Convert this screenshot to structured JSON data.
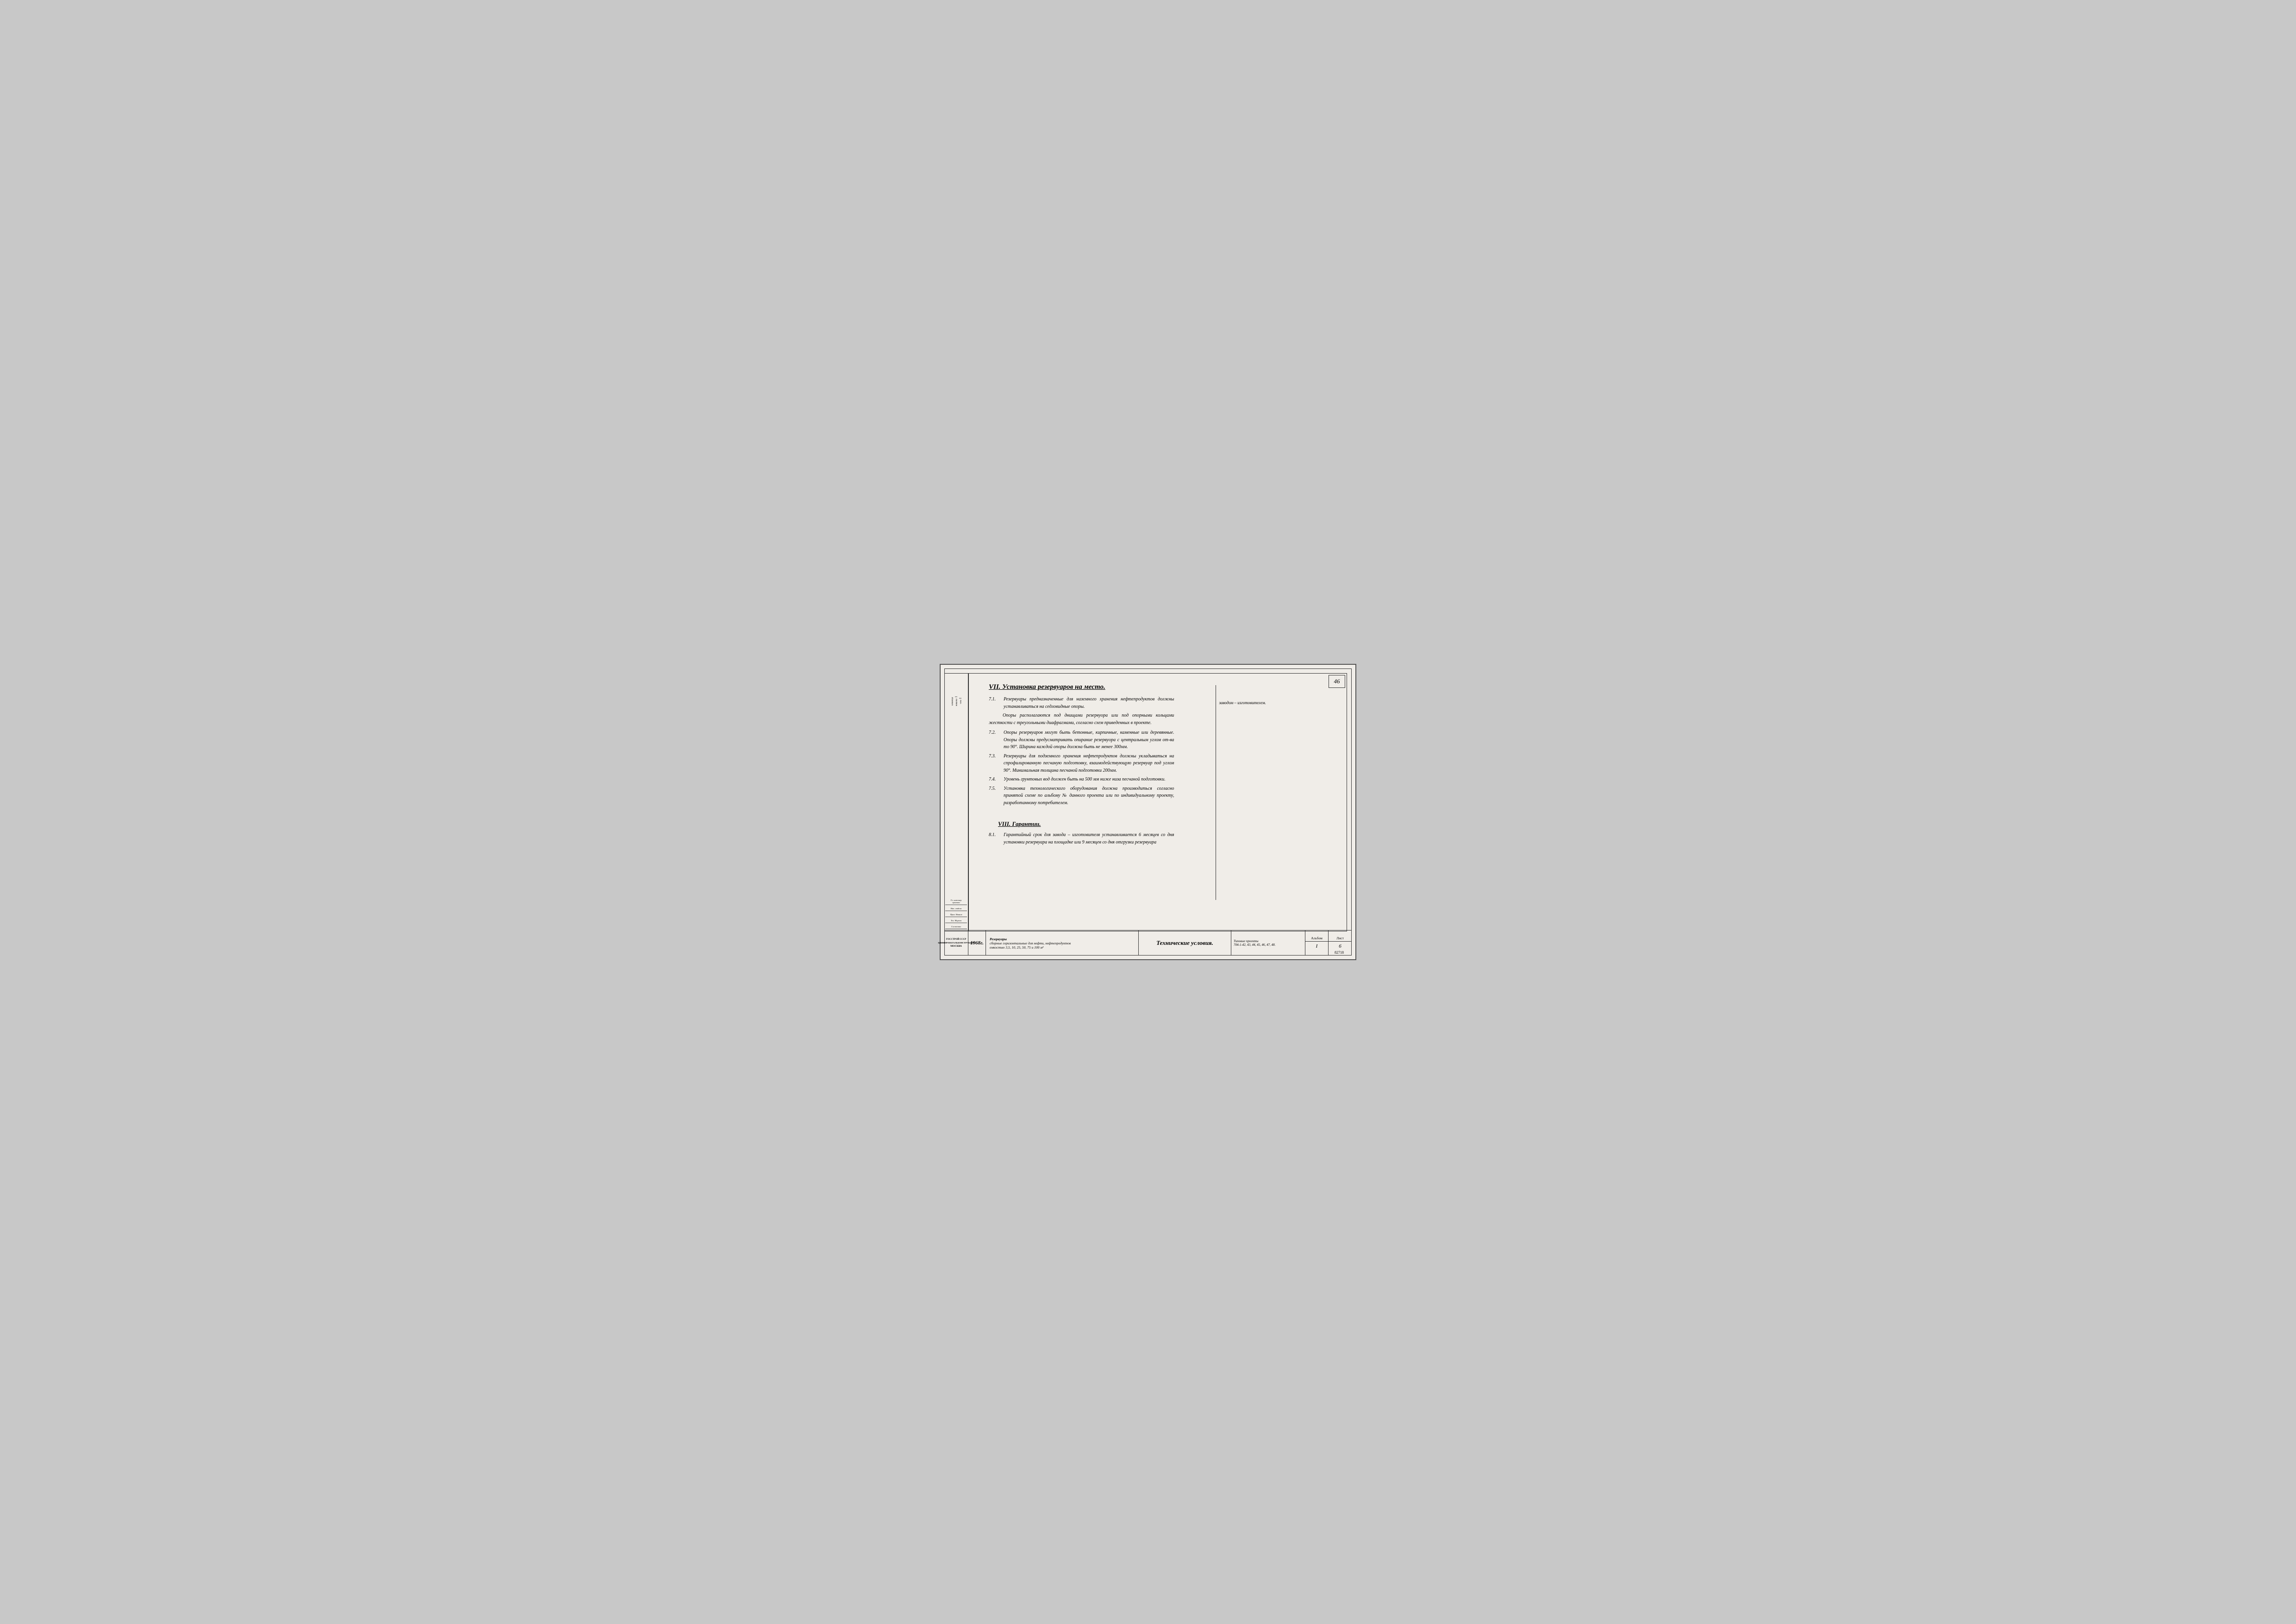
{
  "page": {
    "page_number": "46",
    "doc_code": "82718"
  },
  "header": {
    "section_title": "VII. Установка резервуаров на место.",
    "section_guarantee_title": "VIII. Гарантии."
  },
  "right_note": "заводом – изготовителем.",
  "paragraphs": [
    {
      "num": "7.1.",
      "text": "Резервуары предназначенные для наземного хранения нефтепродуктов должны устанавливаться на седловидные опоры."
    },
    {
      "num": "",
      "text": "Опоры располагаются под днищами резервуара или под опорными кольцами жесткости с треугольными диафрагмами, согласно схем приведенных в проекте."
    },
    {
      "num": "7.2.",
      "text": "Опоры резервуаров могут быть бетонные, кирпичные, каменные или деревянные. Опоры должны предусматривать опирание резервуара с центральным углом от-ва то 90°. Ширина каждой опоры должна быть не менее 300мм."
    },
    {
      "num": "7.3.",
      "text": "Резервуары для подземного хранения нефтепродуктов должны укладываться на спрофилированную песчаную подготовку, взаимодействующую резервуар под углом 90°. Минимальная толщина песчаной подготовки 200мм."
    },
    {
      "num": "7.4.",
      "text": "Уровень грунтовых вод должен быть на 500 мм ниже низа песчаной подготовки."
    },
    {
      "num": "7.5.",
      "text": "Установка технологического оборудования должна производиться согласно принятой схеме по альбому № данного проекта или по индивидуальному проекту, разработанному потребителем."
    }
  ],
  "guarantee_paragraphs": [
    {
      "num": "8.1.",
      "text": "Гарантийный срок для завода – изготовителя устанавливается 6 месяцев со дня установки резервуара на площадке или 9 месяцев со дня отгрузки резервуара"
    }
  ],
  "bottom": {
    "org_line1": "ГОССТРОЙ СССР",
    "org_line2": "ЦНИИПРОЕКТАЛЬКОНСТРУКЦИЯ",
    "org_line3": "МОСКВА",
    "year": "1968г.",
    "description_line1": "Резервуары",
    "description_line2": "сборные горизонтальные для нефти, нефтепродуктов",
    "description_line3": "емкостью 3,5, 10, 25, 50, 75 и 100 м³",
    "center_title": "Технические условия.",
    "gost_label": "Типовые проекты",
    "gost_numbers": "704-1-42, 43, 44, 45, 46, 47, 48.",
    "album_label": "Альбом",
    "album_value": "I",
    "list_label": "Лист",
    "list_value": "6"
  },
  "sidebar": {
    "top_labels": [
      "Изменен",
      "Листов",
      "Поз."
    ],
    "sig_labels": [
      "Гл. инженер проекта",
      "Нач. отдела",
      "Гл. специалист",
      "Пров. Иванов",
      "Тех. Мороза",
      "Согласовал"
    ]
  }
}
